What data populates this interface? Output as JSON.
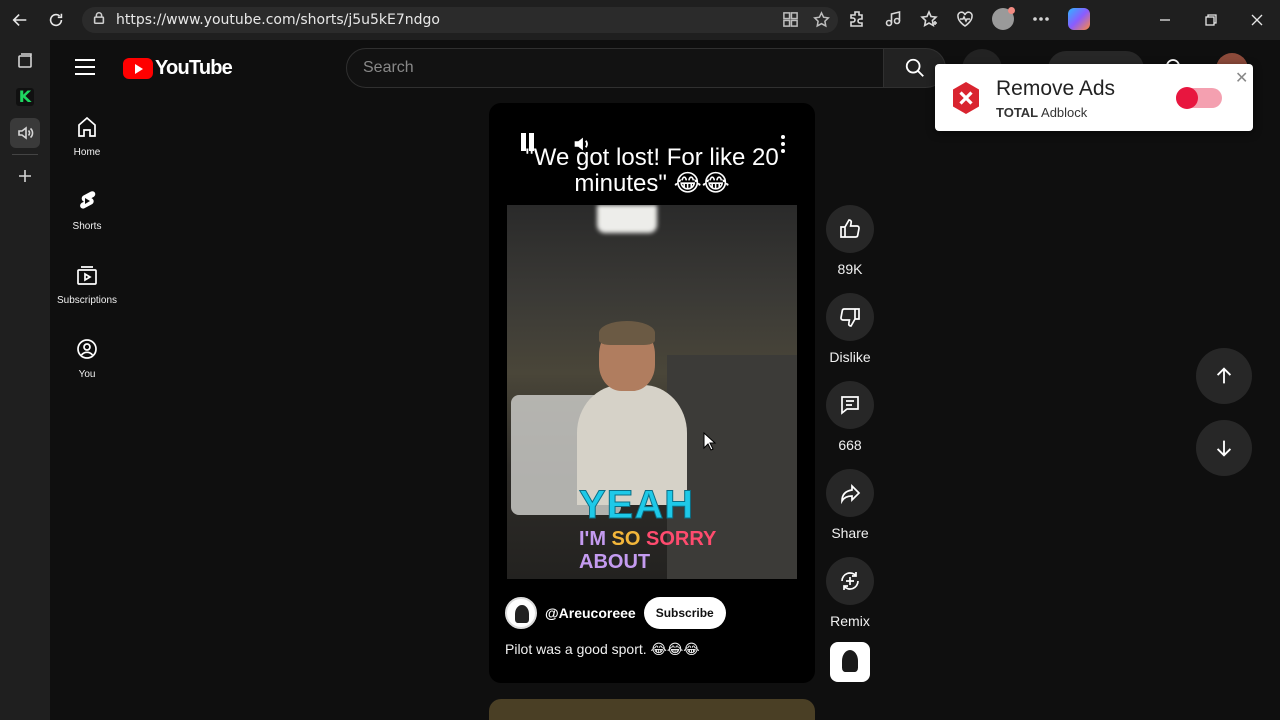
{
  "browser": {
    "url": "https://www.youtube.com/shorts/j5u5kE7ndgo"
  },
  "header": {
    "logo_text": "YouTube",
    "search_placeholder": "Search"
  },
  "guide": {
    "items": [
      {
        "label": "Home",
        "icon": "home-icon"
      },
      {
        "label": "Shorts",
        "icon": "shorts-icon"
      },
      {
        "label": "Subscriptions",
        "icon": "subscriptions-icon"
      },
      {
        "label": "You",
        "icon": "you-icon"
      }
    ]
  },
  "short": {
    "title": "\"We got lost! For like 20 minutes\" 😂😂",
    "caption_line1": "YEAH",
    "caption_im": "I'M ",
    "caption_so": "SO ",
    "caption_sorry": "SORRY",
    "caption_line3": "ABOUT",
    "channel": "@Areucoreee",
    "subscribe_label": "Subscribe",
    "description": "Pilot was a good sport. 😂😂😂"
  },
  "actions": {
    "like_count": "89K",
    "dislike_label": "Dislike",
    "comment_count": "668",
    "share_label": "Share",
    "remix_label": "Remix"
  },
  "adblock": {
    "title": "Remove Ads",
    "brand_bold": "TOTAL",
    "brand_rest": "Adblock",
    "toggle_color": "#e8163f"
  },
  "colors": {
    "brand_red": "#ff0000",
    "caption_cyan": "#1ec9e8"
  }
}
